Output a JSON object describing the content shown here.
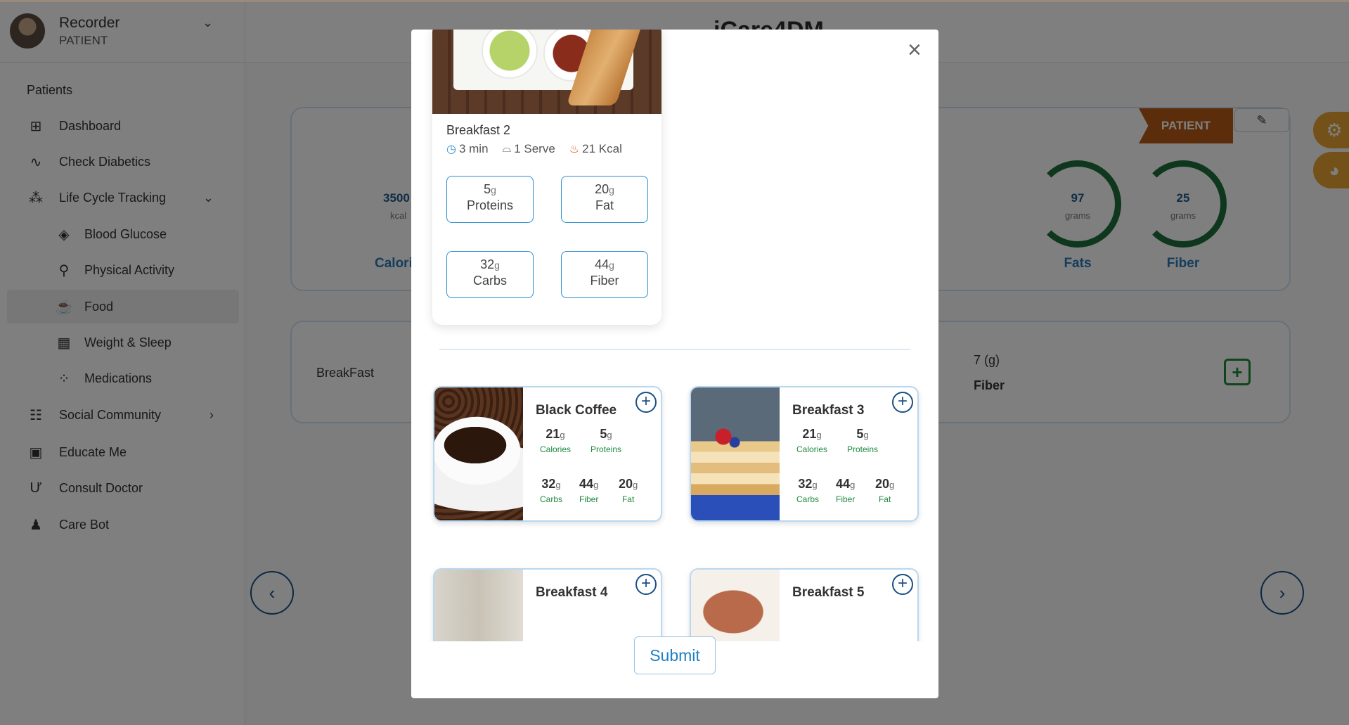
{
  "user": {
    "name": "Recorder",
    "role": "PATIENT"
  },
  "sidebar": {
    "section": "Patients",
    "items": [
      {
        "label": "Dashboard",
        "icon": "dashboard-icon"
      },
      {
        "label": "Check Diabetics",
        "icon": "pulse-icon"
      },
      {
        "label": "Life Cycle Tracking",
        "icon": "footsteps-icon"
      },
      {
        "label": "Blood Glucose",
        "icon": "drop-icon"
      },
      {
        "label": "Physical Activity",
        "icon": "activity-icon"
      },
      {
        "label": "Food",
        "icon": "food-icon"
      },
      {
        "label": "Weight & Sleep",
        "icon": "scale-icon"
      },
      {
        "label": "Medications",
        "icon": "pills-icon"
      },
      {
        "label": "Social Community",
        "icon": "community-icon"
      },
      {
        "label": "Educate Me",
        "icon": "book-icon"
      },
      {
        "label": "Consult Doctor",
        "icon": "stethoscope-icon"
      },
      {
        "label": "Care Bot",
        "icon": "bot-icon"
      }
    ]
  },
  "header": {
    "logo": "iCare4DM"
  },
  "summary": {
    "calories": {
      "value": "3500",
      "unit": "kcal",
      "title": "Calori"
    },
    "fats": {
      "value": "97",
      "unit": "grams",
      "title": "Fats"
    },
    "fiber": {
      "value": "25",
      "unit": "grams",
      "title": "Fiber"
    },
    "patient_tag": "PATIENT"
  },
  "meal_row": {
    "label": "BreakFast",
    "fiber_value": "7 (g)",
    "fiber_label": "Fiber"
  },
  "modal": {
    "selected": {
      "title": "Breakfast 2",
      "time": "3 min",
      "serve": "1 Serve",
      "kcal": "21 Kcal",
      "proteins": "5",
      "fat": "20",
      "carbs": "32",
      "fiber": "44",
      "unit": "g",
      "proteins_label": "Proteins",
      "fat_label": "Fat",
      "carbs_label": "Carbs",
      "fiber_label": "Fiber"
    },
    "foods": [
      {
        "name": "Black Coffee",
        "calories": "21",
        "proteins": "5",
        "carbs": "32",
        "fiber": "44",
        "fat": "20"
      },
      {
        "name": "Breakfast 3",
        "calories": "21",
        "proteins": "5",
        "carbs": "32",
        "fiber": "44",
        "fat": "20"
      },
      {
        "name": "Breakfast 4"
      },
      {
        "name": "Breakfast 5"
      }
    ],
    "labels": {
      "calories": "Calories",
      "proteins": "Proteins",
      "carbs": "Carbs",
      "fiber": "Fiber",
      "fat": "Fat",
      "unit": "g"
    },
    "submit": "Submit"
  },
  "colors": {
    "accent": "#1d7fc4",
    "ring": "#1f6e3a",
    "tag": "#b85b14",
    "fab": "#e8a230"
  }
}
